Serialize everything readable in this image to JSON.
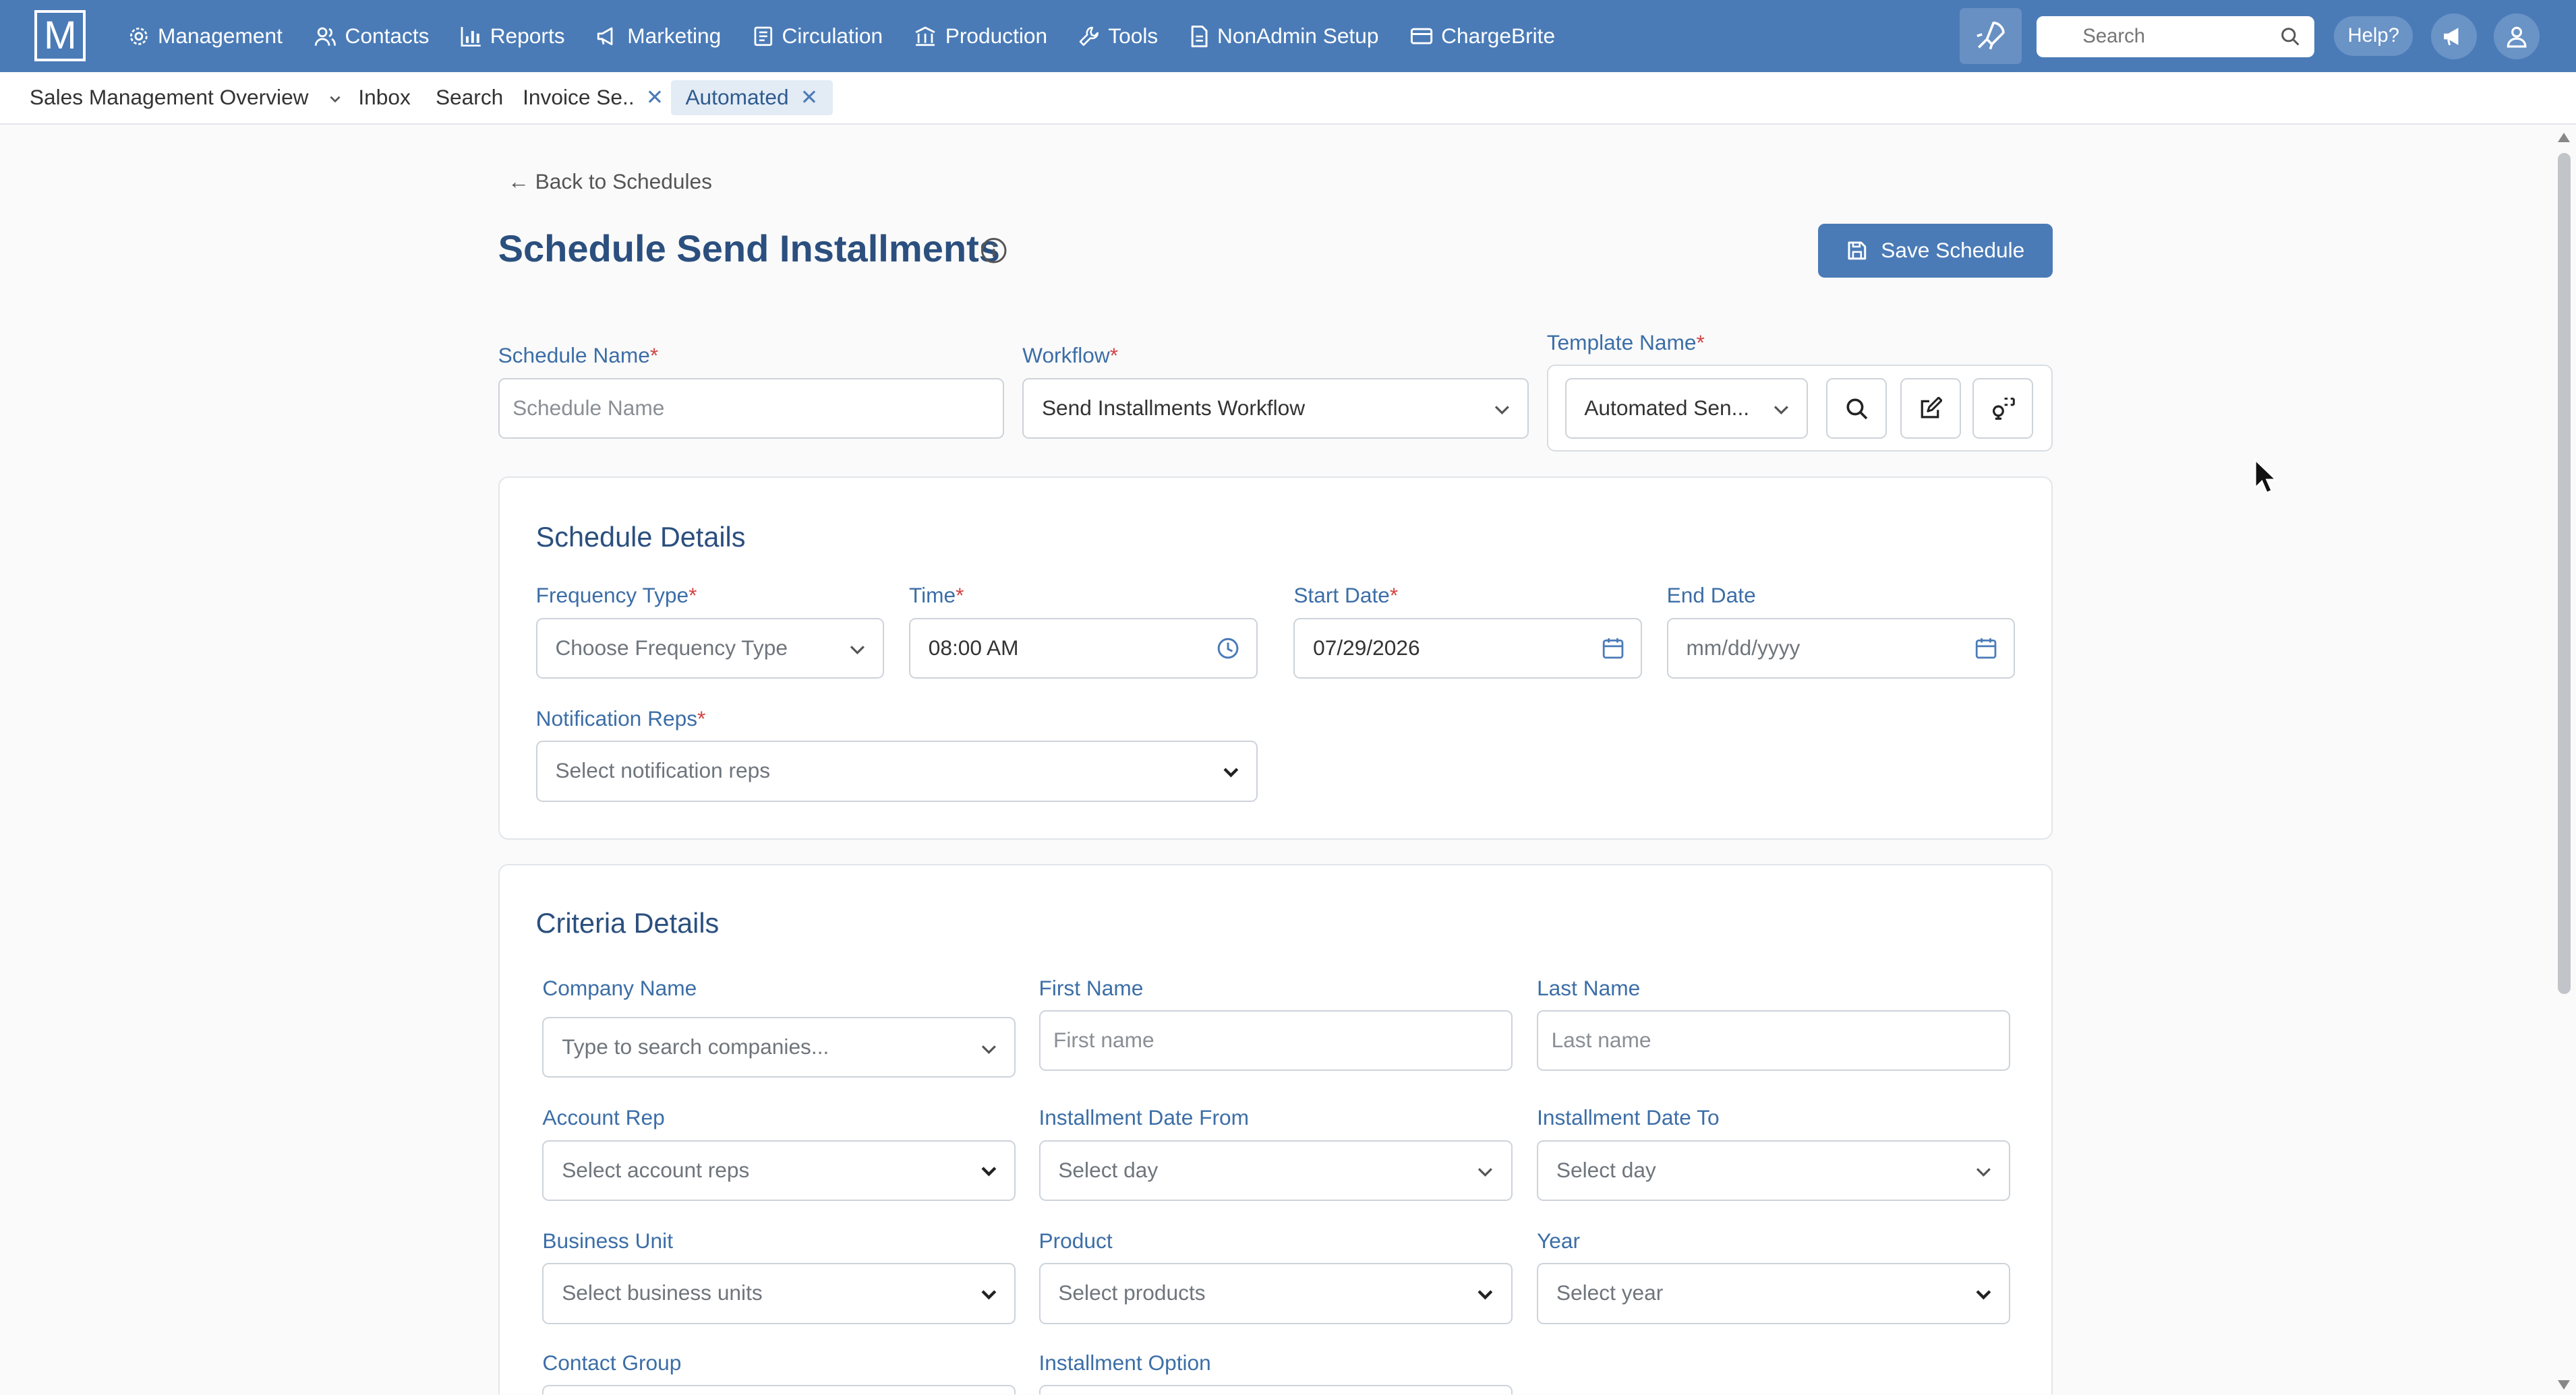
{
  "app": {
    "logo_letter": "M",
    "nav": [
      {
        "label": "Management",
        "icon": "gear-icon"
      },
      {
        "label": "Contacts",
        "icon": "users-icon"
      },
      {
        "label": "Reports",
        "icon": "bar-chart-icon"
      },
      {
        "label": "Marketing",
        "icon": "megaphone-icon"
      },
      {
        "label": "Circulation",
        "icon": "newspaper-icon"
      },
      {
        "label": "Production",
        "icon": "columns-icon"
      },
      {
        "label": "Tools",
        "icon": "wrench-icon"
      },
      {
        "label": "NonAdmin Setup",
        "icon": "document-icon"
      },
      {
        "label": "ChargeBrite",
        "icon": "credit-card-icon"
      }
    ],
    "search_placeholder": "Search",
    "help_label": "Help?",
    "colors": {
      "nav_bg": "#4a7bb7",
      "primary": "#4a7bb7",
      "title": "#2b4f7e",
      "label": "#3c6ea7",
      "required": "#d34545"
    }
  },
  "tabs": [
    {
      "label": "Sales Management Overview",
      "dropdown": true
    },
    {
      "label": "Inbox"
    },
    {
      "label": "Search"
    },
    {
      "label": "Invoice Se..",
      "closable": true
    },
    {
      "label": "Automated",
      "closable": true,
      "active": true
    }
  ],
  "page": {
    "back_link": "← Back to Schedules",
    "title": "Schedule Send Installments",
    "save_label": "Save Schedule"
  },
  "top_fields": {
    "schedule_name": {
      "label": "Schedule Name",
      "placeholder": "Schedule Name"
    },
    "workflow": {
      "label": "Workflow",
      "value": "Send Installments Workflow"
    },
    "template": {
      "label": "Template Name",
      "value": "Automated Sen..."
    }
  },
  "schedule_details": {
    "title": "Schedule Details",
    "frequency": {
      "label": "Frequency Type",
      "placeholder": "Choose Frequency Type"
    },
    "time": {
      "label": "Time",
      "value": "08:00 AM"
    },
    "start_date": {
      "label": "Start Date",
      "value": "07/29/2026"
    },
    "end_date": {
      "label": "End Date",
      "placeholder": "mm/dd/yyyy"
    },
    "notification_reps": {
      "label": "Notification Reps",
      "placeholder": "Select notification reps"
    }
  },
  "criteria": {
    "title": "Criteria Details",
    "company_name": {
      "label": "Company Name",
      "placeholder": "Type to search companies..."
    },
    "first_name": {
      "label": "First Name",
      "placeholder": "First name"
    },
    "last_name": {
      "label": "Last Name",
      "placeholder": "Last name"
    },
    "account_rep": {
      "label": "Account Rep",
      "placeholder": "Select account reps"
    },
    "installment_from": {
      "label": "Installment Date From",
      "placeholder": "Select day"
    },
    "installment_to": {
      "label": "Installment Date To",
      "placeholder": "Select day"
    },
    "business_unit": {
      "label": "Business Unit",
      "placeholder": "Select business units"
    },
    "product": {
      "label": "Product",
      "placeholder": "Select products"
    },
    "year": {
      "label": "Year",
      "placeholder": "Select year"
    },
    "contact_group": {
      "label": "Contact Group"
    },
    "installment_option": {
      "label": "Installment Option"
    }
  },
  "required_mark": "*"
}
